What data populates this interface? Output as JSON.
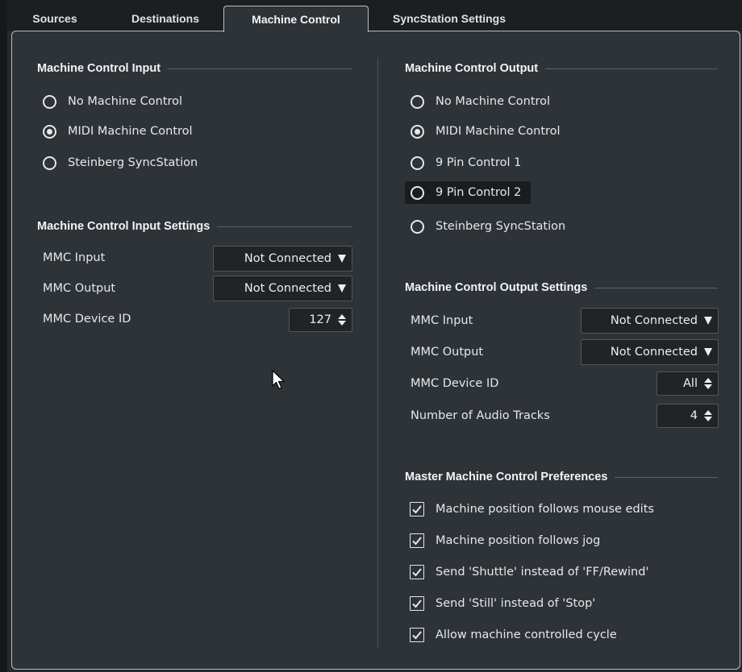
{
  "tabs": [
    {
      "label": "Sources"
    },
    {
      "label": "Destinations"
    },
    {
      "label": "Machine Control"
    },
    {
      "label": "SyncStation Settings"
    }
  ],
  "active_tab": "Machine Control",
  "left": {
    "input_title": "Machine Control Input",
    "input_options": [
      {
        "label": "No Machine Control",
        "selected": false
      },
      {
        "label": "MIDI Machine Control",
        "selected": true
      },
      {
        "label": "Steinberg SyncStation",
        "selected": false
      }
    ],
    "settings_title": "Machine Control Input Settings",
    "mmc_input_label": "MMC Input",
    "mmc_input_value": "Not Connected",
    "mmc_output_label": "MMC Output",
    "mmc_output_value": "Not Connected",
    "device_id_label": "MMC Device ID",
    "device_id_value": "127"
  },
  "right": {
    "output_title": "Machine Control Output",
    "output_options": [
      {
        "label": "No Machine Control",
        "selected": false
      },
      {
        "label": "MIDI Machine Control",
        "selected": true
      },
      {
        "label": "9 Pin Control 1",
        "selected": false
      },
      {
        "label": "9 Pin Control 2",
        "selected": false
      },
      {
        "label": "Steinberg SyncStation",
        "selected": false
      }
    ],
    "settings_title": "Machine Control Output Settings",
    "mmc_input_label": "MMC Input",
    "mmc_input_value": "Not Connected",
    "mmc_output_label": "MMC Output",
    "mmc_output_value": "Not Connected",
    "device_id_label": "MMC Device ID",
    "device_id_value": "All",
    "audio_tracks_label": "Number of Audio Tracks",
    "audio_tracks_value": "4",
    "prefs_title": "Master Machine Control Preferences",
    "prefs": [
      {
        "label": "Machine position follows mouse edits",
        "checked": true
      },
      {
        "label": "Machine position follows jog",
        "checked": true
      },
      {
        "label": "Send 'Shuttle' instead of 'FF/Rewind'",
        "checked": true
      },
      {
        "label": "Send 'Still' instead of 'Stop'",
        "checked": true
      },
      {
        "label": "Allow machine controlled cycle",
        "checked": true
      }
    ]
  },
  "icons": {
    "radio": "radio-button-icon",
    "checkbox": "checkmark-icon",
    "dropdown": "caret-down-icon",
    "spinner": "up-down-arrows-icon",
    "cursor": "mouse-pointer-icon"
  }
}
